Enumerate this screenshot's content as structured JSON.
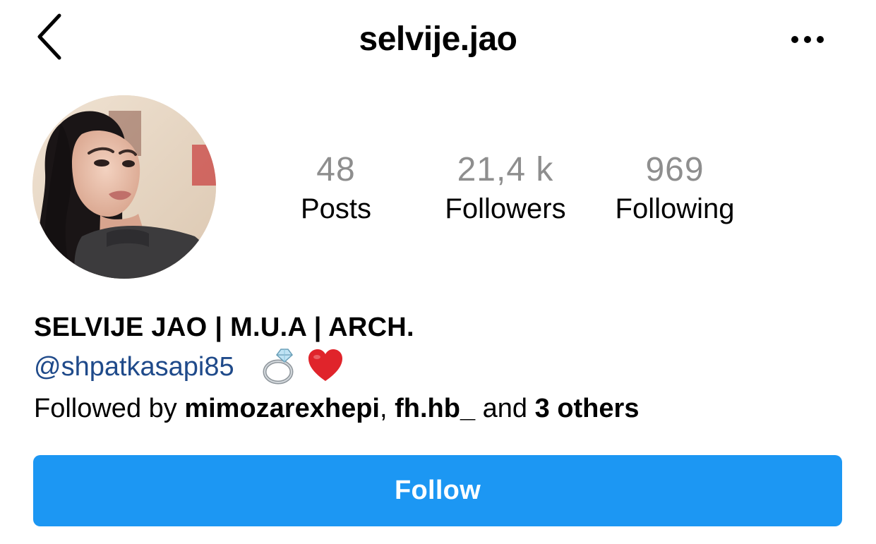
{
  "header": {
    "username": "selvije.jao",
    "back_icon": "chevron-left-icon",
    "more_icon": "more-horizontal-icon"
  },
  "profile": {
    "avatar_icon": "profile-photo",
    "stats": {
      "posts": {
        "value": "48",
        "label": "Posts"
      },
      "followers": {
        "value": "21,4 k",
        "label": "Followers"
      },
      "following": {
        "value": "969",
        "label": "Following"
      }
    }
  },
  "bio": {
    "display_name": "SELVIJE JAO | M.U.A | ARCH.",
    "mention": "@shpatkasapi85",
    "emojis": [
      "ring-emoji",
      "red-heart-emoji"
    ],
    "followed_by_prefix": "Followed by ",
    "followed_by_user1": "mimozarexhepi",
    "followed_by_sep": ", ",
    "followed_by_user2": "fh.hb_",
    "followed_by_and": " and ",
    "followed_by_others": "3 others"
  },
  "actions": {
    "follow_label": "Follow"
  },
  "colors": {
    "follow_button": "#1c97f3",
    "stat_value": "#8e8e8e",
    "mention": "#1f4a8a",
    "heart": "#e0242b"
  }
}
